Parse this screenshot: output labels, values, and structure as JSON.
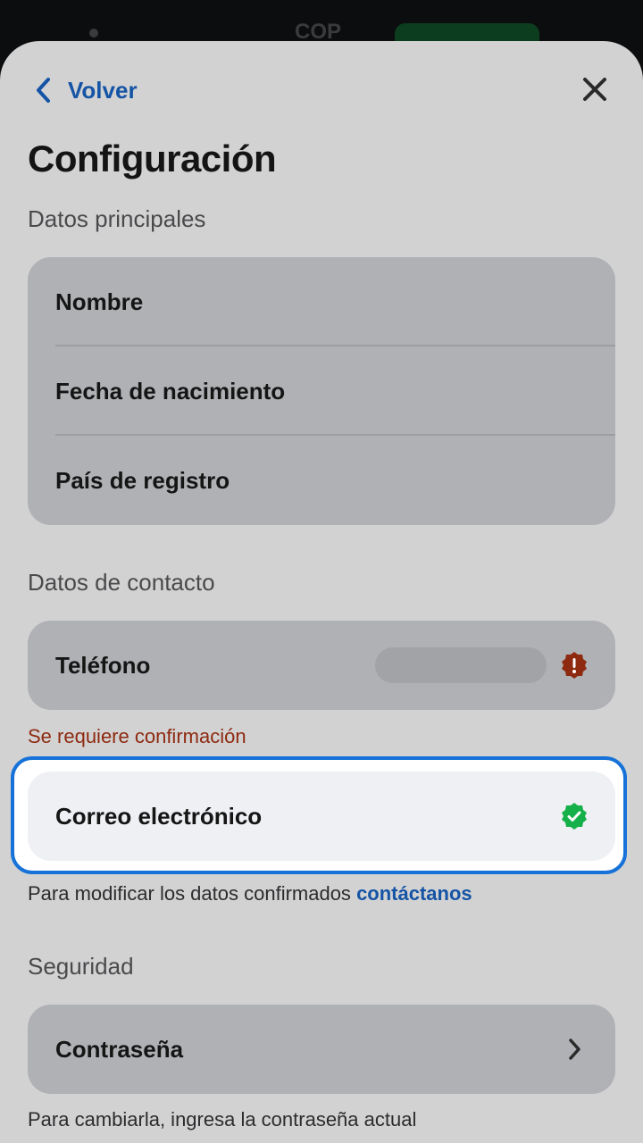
{
  "background": {
    "currency": "COP"
  },
  "header": {
    "back_label": "Volver",
    "back_icon": "chevron-left-icon",
    "close_icon": "close-icon",
    "title": "Configuración"
  },
  "main_data": {
    "heading": "Datos principales",
    "rows": [
      {
        "label": "Nombre"
      },
      {
        "label": "Fecha de nacimiento"
      },
      {
        "label": "País de registro"
      }
    ]
  },
  "contact": {
    "heading": "Datos de contacto",
    "phone": {
      "label": "Teléfono",
      "status_icon": "alert-badge-icon",
      "warning": "Se requiere confirmación"
    },
    "email": {
      "label": "Correo electrónico",
      "status_icon": "verified-badge-icon"
    },
    "hint_text": "Para modificar los datos confirmados",
    "hint_link": "contáctanos"
  },
  "security": {
    "heading": "Seguridad",
    "password_label": "Contraseña",
    "password_hint": "Para cambiarla, ingresa la contraseña actual"
  },
  "colors": {
    "accent": "#1554a5",
    "highlight": "#1672d8",
    "warning": "#8e2a10",
    "success": "#16b04a"
  }
}
